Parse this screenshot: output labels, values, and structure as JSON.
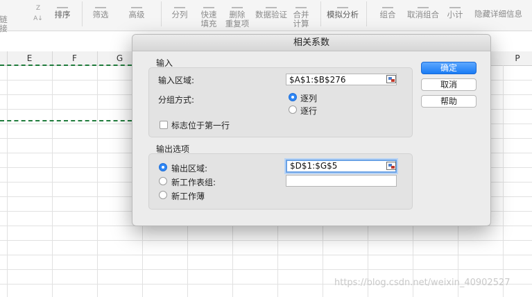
{
  "ribbon": {
    "items": [
      {
        "label": "链接"
      },
      {
        "label": "排序"
      },
      {
        "label": "筛选"
      },
      {
        "label": "高级"
      },
      {
        "label": "分列"
      },
      {
        "label": "快速\n填充"
      },
      {
        "label": "删除\n重复项"
      },
      {
        "label": "数据验证"
      },
      {
        "label": "合并\n计算"
      },
      {
        "label": "模拟分析"
      },
      {
        "label": "组合"
      },
      {
        "label": "取消组合"
      },
      {
        "label": "小计"
      },
      {
        "label": "隐藏详细信息"
      }
    ]
  },
  "sheet": {
    "columns": [
      "E",
      "F",
      "G",
      "P"
    ]
  },
  "dialog": {
    "title": "相关系数",
    "input_group": {
      "title": "输入",
      "range_label": "输入区域:",
      "range_value": "$A$1:$B$276",
      "grouping_label": "分组方式:",
      "by_column": "逐列",
      "by_row": "逐行",
      "labels_first_row": "标志位于第一行"
    },
    "output_group": {
      "title": "输出选项",
      "output_range_label": "输出区域:",
      "output_range_value": "$D$1:$G$5",
      "new_sheet_label": "新工作表组:",
      "new_sheet_value": "",
      "new_workbook_label": "新工作薄"
    },
    "buttons": {
      "ok": "确定",
      "cancel": "取消",
      "help": "帮助"
    }
  },
  "watermark": "https://blog.csdn.net/weixin_40902527",
  "colors": {
    "accent": "#1a7cf5",
    "marquee": "#1e7b3a"
  }
}
